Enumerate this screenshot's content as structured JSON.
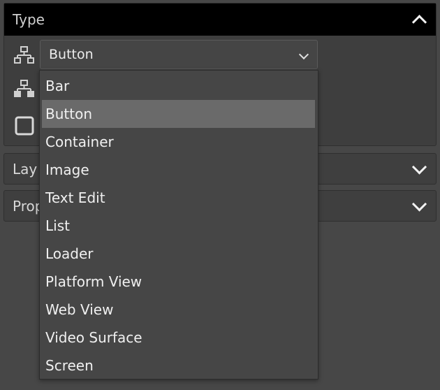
{
  "type_section": {
    "title": "Type",
    "selected_value": "Button"
  },
  "layout_section": {
    "title_visible": "Lay"
  },
  "properties_section": {
    "title_visible": "Prop"
  },
  "dropdown": {
    "items": [
      {
        "label": "Bar"
      },
      {
        "label": "Button"
      },
      {
        "label": "Container"
      },
      {
        "label": "Image"
      },
      {
        "label": "Text Edit"
      },
      {
        "label": "List"
      },
      {
        "label": "Loader"
      },
      {
        "label": "Platform View"
      },
      {
        "label": "Web View"
      },
      {
        "label": "Video Surface"
      },
      {
        "label": "Screen"
      }
    ],
    "selected": "Button"
  },
  "colors": {
    "header_bg": "#000000",
    "panel_bg": "#3f3f3f",
    "highlight": "#6a6a6a"
  }
}
